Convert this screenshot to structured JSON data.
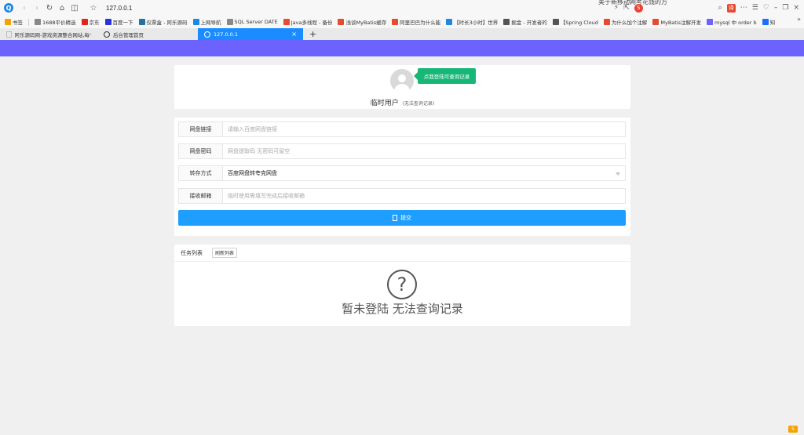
{
  "browser": {
    "url": "127.0.0.1",
    "top_news": "美于新移动网考花钱的方",
    "bookmarks": [
      {
        "label": "书签",
        "color": "#f4a300"
      },
      {
        "label": "1688平价精选",
        "color": "#888888"
      },
      {
        "label": "京东",
        "color": "#e1251b"
      },
      {
        "label": "百度一下",
        "color": "#2932e1"
      },
      {
        "label": "仅票盒 - 阿乐源码",
        "color": "#21759b"
      },
      {
        "label": "上网导航",
        "color": "#1e88e5"
      },
      {
        "label": "SQL Server DATE",
        "color": "#888888"
      },
      {
        "label": "Java多线程 - 备份",
        "color": "#e8492f"
      },
      {
        "label": "浅谈MyBatis缓存",
        "color": "#e8492f"
      },
      {
        "label": "阿里巴巴为什么能",
        "color": "#e8492f"
      },
      {
        "label": "【时长3小时】世界",
        "color": "#1e88e5"
      },
      {
        "label": "掘金 - 开发者的",
        "color": "#555555"
      },
      {
        "label": "【Spring Cloud",
        "color": "#555555"
      },
      {
        "label": "为什么加个注解",
        "color": "#e8492f"
      },
      {
        "label": "MyBatis注解开发",
        "color": "#e8492f"
      },
      {
        "label": "mysql 中 order b",
        "color": "#6c63ff"
      },
      {
        "label": "知",
        "color": "#1772f6"
      }
    ],
    "tabs": [
      {
        "label": "阿乐源码网-游戏资源整合网站,每个游",
        "active": false
      },
      {
        "label": "后台管理首页",
        "active": false
      },
      {
        "label": "127.0.0.1",
        "active": true
      }
    ],
    "icons": {
      "close": "×",
      "new_tab": "+",
      "more_bookmarks": "»"
    }
  },
  "user_card": {
    "login_tip": "点我登陆可查询记录",
    "user_name": "临时用户",
    "user_note": "(无法查询记录)"
  },
  "form": {
    "link_label": "网盘链接",
    "link_placeholder": "请输入百度网盘链接",
    "code_label": "网盘密码",
    "code_placeholder": "网盘提取码 无密码可留空",
    "method_label": "转存方式",
    "method_value": "百度网盘转夸克网盘",
    "email_label": "接收邮箱",
    "email_placeholder": "临时使用需填写完成后接收邮箱",
    "submit_label": "提交"
  },
  "task": {
    "title": "任务列表",
    "refresh_label": "刷新列表",
    "empty_icon": "?",
    "empty_text": "暂未登陆 无法查询记录"
  },
  "colors": {
    "header_band": "#6c63ff",
    "accent_blue": "#1e9fff",
    "tip_green": "#16b777"
  }
}
